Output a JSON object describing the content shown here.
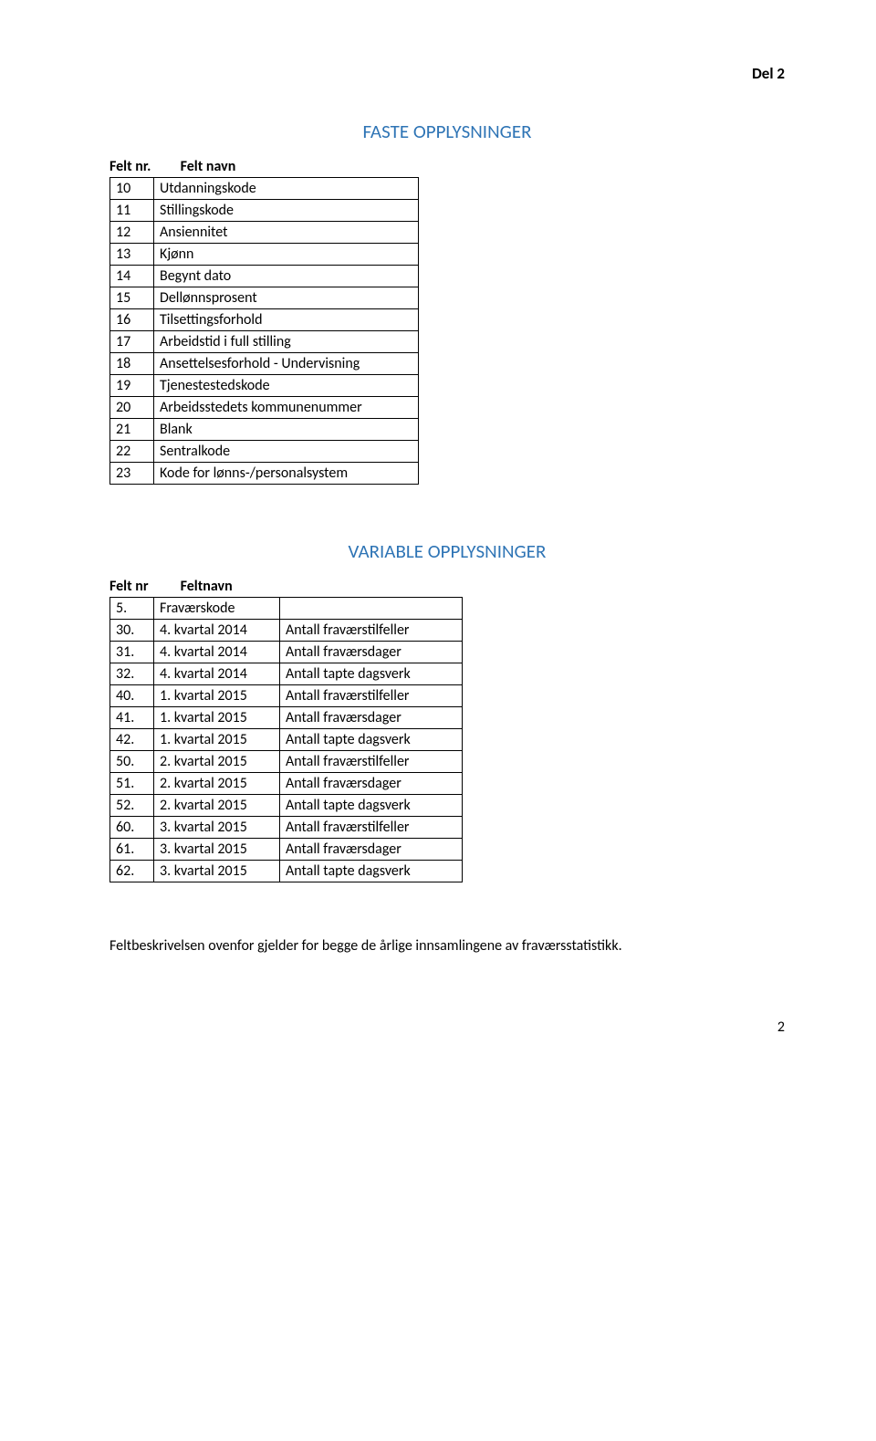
{
  "header": {
    "partLabel": "Del 2"
  },
  "section1": {
    "title": "FASTE OPPLYSNINGER",
    "col1Header": "Felt nr.",
    "col2Header": "Felt navn",
    "rows": [
      {
        "nr": "10",
        "navn": "Utdanningskode"
      },
      {
        "nr": "11",
        "navn": "Stillingskode"
      },
      {
        "nr": "12",
        "navn": "Ansiennitet"
      },
      {
        "nr": "13",
        "navn": "Kjønn"
      },
      {
        "nr": "14",
        "navn": "Begynt dato"
      },
      {
        "nr": "15",
        "navn": "Dellønnsprosent"
      },
      {
        "nr": "16",
        "navn": "Tilsettingsforhold"
      },
      {
        "nr": "17",
        "navn": "Arbeidstid i full stilling"
      },
      {
        "nr": "18",
        "navn": "Ansettelsesforhold - Undervisning"
      },
      {
        "nr": "19",
        "navn": "Tjenestestedskode"
      },
      {
        "nr": "20",
        "navn": "Arbeidsstedets kommunenummer"
      },
      {
        "nr": "21",
        "navn": "Blank"
      },
      {
        "nr": "22",
        "navn": "Sentralkode"
      },
      {
        "nr": "23",
        "navn": "Kode for lønns-/personalsystem"
      }
    ]
  },
  "section2": {
    "title": "VARIABLE OPPLYSNINGER",
    "col1Header": "Felt nr",
    "col2Header": "Feltnavn",
    "rows": [
      {
        "nr": "5.",
        "c2": "Fraværskode",
        "c3": ""
      },
      {
        "nr": "30.",
        "c2": "4. kvartal 2014",
        "c3": "Antall fraværstilfeller"
      },
      {
        "nr": "31.",
        "c2": "4. kvartal 2014",
        "c3": "Antall fraværsdager"
      },
      {
        "nr": "32.",
        "c2": "4. kvartal 2014",
        "c3": "Antall tapte dagsverk"
      },
      {
        "nr": "40.",
        "c2": "1. kvartal 2015",
        "c3": "Antall fraværstilfeller"
      },
      {
        "nr": "41.",
        "c2": "1. kvartal 2015",
        "c3": "Antall fraværsdager"
      },
      {
        "nr": "42.",
        "c2": "1. kvartal 2015",
        "c3": "Antall tapte dagsverk"
      },
      {
        "nr": "50.",
        "c2": "2. kvartal 2015",
        "c3": "Antall fraværstilfeller"
      },
      {
        "nr": "51.",
        "c2": "2. kvartal 2015",
        "c3": "Antall fraværsdager"
      },
      {
        "nr": "52.",
        "c2": "2. kvartal 2015",
        "c3": "Antall tapte dagsverk"
      },
      {
        "nr": "60.",
        "c2": "3. kvartal 2015",
        "c3": "Antall fraværstilfeller"
      },
      {
        "nr": "61.",
        "c2": "3. kvartal 2015",
        "c3": "Antall fraværsdager"
      },
      {
        "nr": "62.",
        "c2": "3. kvartal 2015",
        "c3": "Antall tapte dagsverk"
      }
    ]
  },
  "footer": {
    "text": "Feltbeskrivelsen ovenfor gjelder for begge de årlige innsamlingene av fraværsstatistikk.",
    "pageNumber": "2"
  }
}
